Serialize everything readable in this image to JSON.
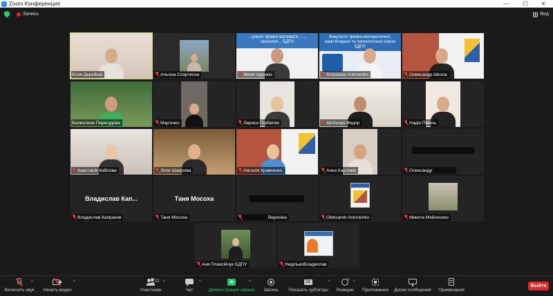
{
  "window": {
    "title": "Zoom Конференция",
    "controls": [
      "—",
      "☐",
      "✕"
    ]
  },
  "topbar": {
    "recording_label": "Запись",
    "view_label": "Вид"
  },
  "colors": {
    "background": "#1a1a1a",
    "active_speaker_border": "#c8e04a",
    "muted_icon": "#e23b3b",
    "share_screen": "#28c76f",
    "leave": "#e02828"
  },
  "participants": [
    {
      "name": "Юлія Деркбіна",
      "muted": false,
      "video": true,
      "active": true
    },
    {
      "name": "Альона Спартесна",
      "muted": true,
      "video": true
    },
    {
      "name": "Женя Адонкін",
      "muted": true,
      "video": true,
      "banner": "...ультет фізико-математи... ... технологі... БДПУ"
    },
    {
      "name": "Anastasia Antonenko",
      "muted": true,
      "video": true,
      "banner": "Факультет фізико-математичної, комп'ютерної та технологічної освіти БДПУ"
    },
    {
      "name": "Олександр Школа",
      "muted": true,
      "video": true
    },
    {
      "name": "Валентина Перегудова",
      "muted": false,
      "video": true
    },
    {
      "name": "Мар'енко",
      "muted": true,
      "video": true
    },
    {
      "name": "Лариса Горбатюк",
      "muted": true,
      "video": true
    },
    {
      "name": "Шпільчук Федор",
      "muted": true,
      "video": true
    },
    {
      "name": "Надія Півень",
      "muted": true,
      "video": true
    },
    {
      "name": "Анастасія Каблова",
      "muted": true,
      "video": true
    },
    {
      "name": "Лілія Шакірова",
      "muted": true,
      "video": true
    },
    {
      "name": "Наталія Кравченко",
      "muted": true,
      "video": true
    },
    {
      "name": "Анна Картінкік",
      "muted": true,
      "video": true
    },
    {
      "name": "Олександр",
      "muted": true,
      "video": false
    },
    {
      "name": "Владислав Капрахов",
      "muted": true,
      "video": false,
      "display": "Владислав Кап..."
    },
    {
      "name": "Таня Мосоха",
      "muted": true,
      "video": false,
      "display": "Таня Мосоха"
    },
    {
      "name": "Вероніка",
      "muted": true,
      "video": false
    },
    {
      "name": "Oleksandr Antonenko",
      "muted": true,
      "video": true
    },
    {
      "name": "Микита Мойсеєнко",
      "muted": true,
      "video": true
    },
    {
      "name": "Аня Плаксійчук БДПУ",
      "muted": true,
      "video": true
    },
    {
      "name": "НедількоВладислав",
      "muted": true,
      "video": true
    }
  ],
  "toolbar": {
    "unmute": "Включить звук",
    "start_video": "Начать видео",
    "participants": "Участники",
    "participants_count": "22",
    "chat": "Чат",
    "share_screen": "Демонстрация экрана",
    "record": "Запись",
    "captions": "Показать субтитры",
    "reactions": "Реакции",
    "apps": "Приложения",
    "whiteboards": "Доски сообщений",
    "notes": "Примечания",
    "leave": "Выйти"
  }
}
